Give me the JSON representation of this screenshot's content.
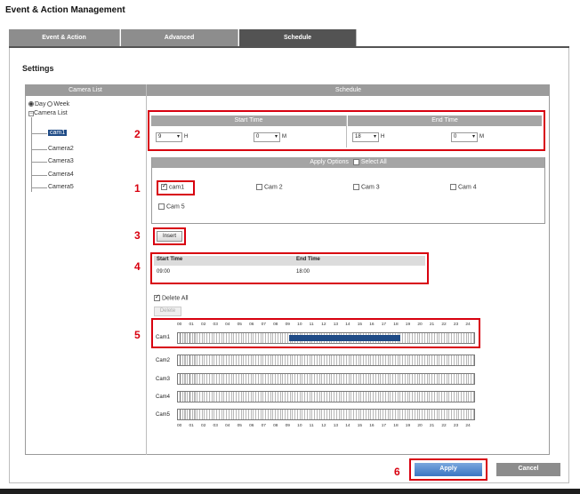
{
  "page_title": "Event & Action Management",
  "tabs": [
    {
      "label": "Event & Action",
      "active": false
    },
    {
      "label": "Advanced",
      "active": false
    },
    {
      "label": "Schedule",
      "active": true
    }
  ],
  "settings_title": "Settings",
  "camera_list": {
    "header": "Camera List",
    "mode_options": [
      "Day",
      "Week"
    ],
    "selected_mode": "Day",
    "tree_root": "Camera List",
    "items": [
      "cam1",
      "Camera2",
      "Camera3",
      "Camera4",
      "Camera5"
    ],
    "selected_item": "cam1"
  },
  "schedule": {
    "header": "Schedule",
    "start_time": {
      "label": "Start Time",
      "hour": "9",
      "hour_unit": "H",
      "minute": "0",
      "minute_unit": "M"
    },
    "end_time": {
      "label": "End Time",
      "hour": "18",
      "hour_unit": "H",
      "minute": "0",
      "minute_unit": "M"
    },
    "apply_options": {
      "label": "Apply Options",
      "select_all_label": "Select All",
      "select_all_checked": false
    },
    "cameras": [
      {
        "label": "cam1",
        "checked": true
      },
      {
        "label": "Cam 2",
        "checked": false
      },
      {
        "label": "Cam 3",
        "checked": false
      },
      {
        "label": "Cam 4",
        "checked": false
      },
      {
        "label": "Cam 5",
        "checked": false
      }
    ],
    "insert_label": "Insert",
    "time_table": {
      "headers": [
        "Start Time",
        "End Time"
      ],
      "rows": [
        [
          "09:00",
          "18:00"
        ]
      ]
    },
    "delete_all_label": "Delete All",
    "delete_all_checked": true,
    "delete_label": "Delete",
    "hours": [
      "00",
      "01",
      "02",
      "03",
      "04",
      "05",
      "06",
      "07",
      "08",
      "09",
      "10",
      "11",
      "12",
      "13",
      "14",
      "15",
      "16",
      "17",
      "18",
      "19",
      "20",
      "21",
      "22",
      "23",
      "24"
    ],
    "grid_rows": [
      {
        "label": "Cam1",
        "range": [
          9,
          18
        ]
      },
      {
        "label": "Cam2",
        "range": null
      },
      {
        "label": "Cam3",
        "range": null
      },
      {
        "label": "Cam4",
        "range": null
      },
      {
        "label": "Cam5",
        "range": null
      }
    ]
  },
  "callouts": [
    "1",
    "2",
    "3",
    "4",
    "5",
    "6"
  ],
  "buttons": {
    "apply": "Apply",
    "cancel": "Cancel"
  },
  "colors": {
    "accent": "#1f4b86",
    "callout": "#d8000f",
    "header": "#9b9b9b"
  }
}
